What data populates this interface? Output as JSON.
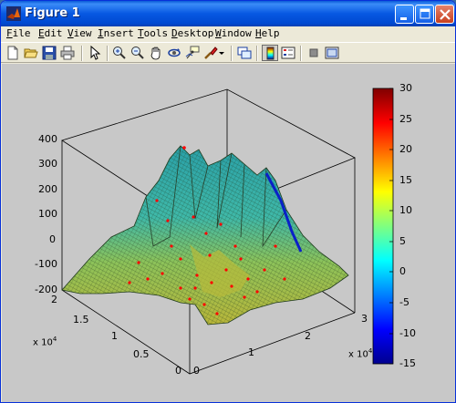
{
  "window": {
    "title": "Figure 1"
  },
  "titlebar": {
    "buttons": [
      "minimize-icon",
      "maximize-icon",
      "close-icon"
    ]
  },
  "menu": [
    {
      "mnemonic": "F",
      "rest": "ile"
    },
    {
      "mnemonic": "E",
      "rest": "dit"
    },
    {
      "mnemonic": "V",
      "rest": "iew"
    },
    {
      "mnemonic": "I",
      "rest": "nsert"
    },
    {
      "mnemonic": "T",
      "rest": "ools"
    },
    {
      "mnemonic": "D",
      "rest": "esktop"
    },
    {
      "mnemonic": "W",
      "rest": "indow"
    },
    {
      "mnemonic": "H",
      "rest": "elp"
    }
  ],
  "toolbar": {
    "tools": [
      "new-figure-icon",
      "open-file-icon",
      "save-icon",
      "print-icon",
      "select-arrow-icon",
      "zoom-in-icon",
      "zoom-out-icon",
      "pan-hand-icon",
      "rotate-3d-icon",
      "data-cursor-icon",
      "brush-icon",
      "link-plot-icon",
      "insert-colorbar-icon",
      "insert-legend-icon",
      "hide-plot-tools-icon",
      "show-plot-tools-icon"
    ]
  },
  "colors": {
    "titlebar": "#0758e2",
    "figure_bg": "#c8c8c8",
    "marker": "#ff0000"
  },
  "chart_data": {
    "type": "surface",
    "title": "",
    "x_axis": {
      "ticks": [
        "0",
        "1",
        "2",
        "3"
      ],
      "exponent_label": "x 10",
      "exponent": "4",
      "range": [
        0,
        30000
      ]
    },
    "y_axis": {
      "ticks": [
        "0",
        "0.5",
        "1",
        "1.5",
        "2"
      ],
      "exponent_label": "x 10",
      "exponent": "4",
      "range": [
        0,
        20000
      ]
    },
    "z_axis": {
      "ticks": [
        "400",
        "300",
        "200",
        "100",
        "0",
        "-100",
        "-200"
      ],
      "range": [
        -200,
        400
      ]
    },
    "colorbar": {
      "ticks": [
        "30",
        "25",
        "20",
        "15",
        "10",
        "5",
        "0",
        "-5",
        "-10",
        "-15"
      ],
      "range": [
        -15,
        30
      ],
      "colormap": "jet"
    },
    "markers": "red dots scattered over the surface",
    "grid": false
  }
}
